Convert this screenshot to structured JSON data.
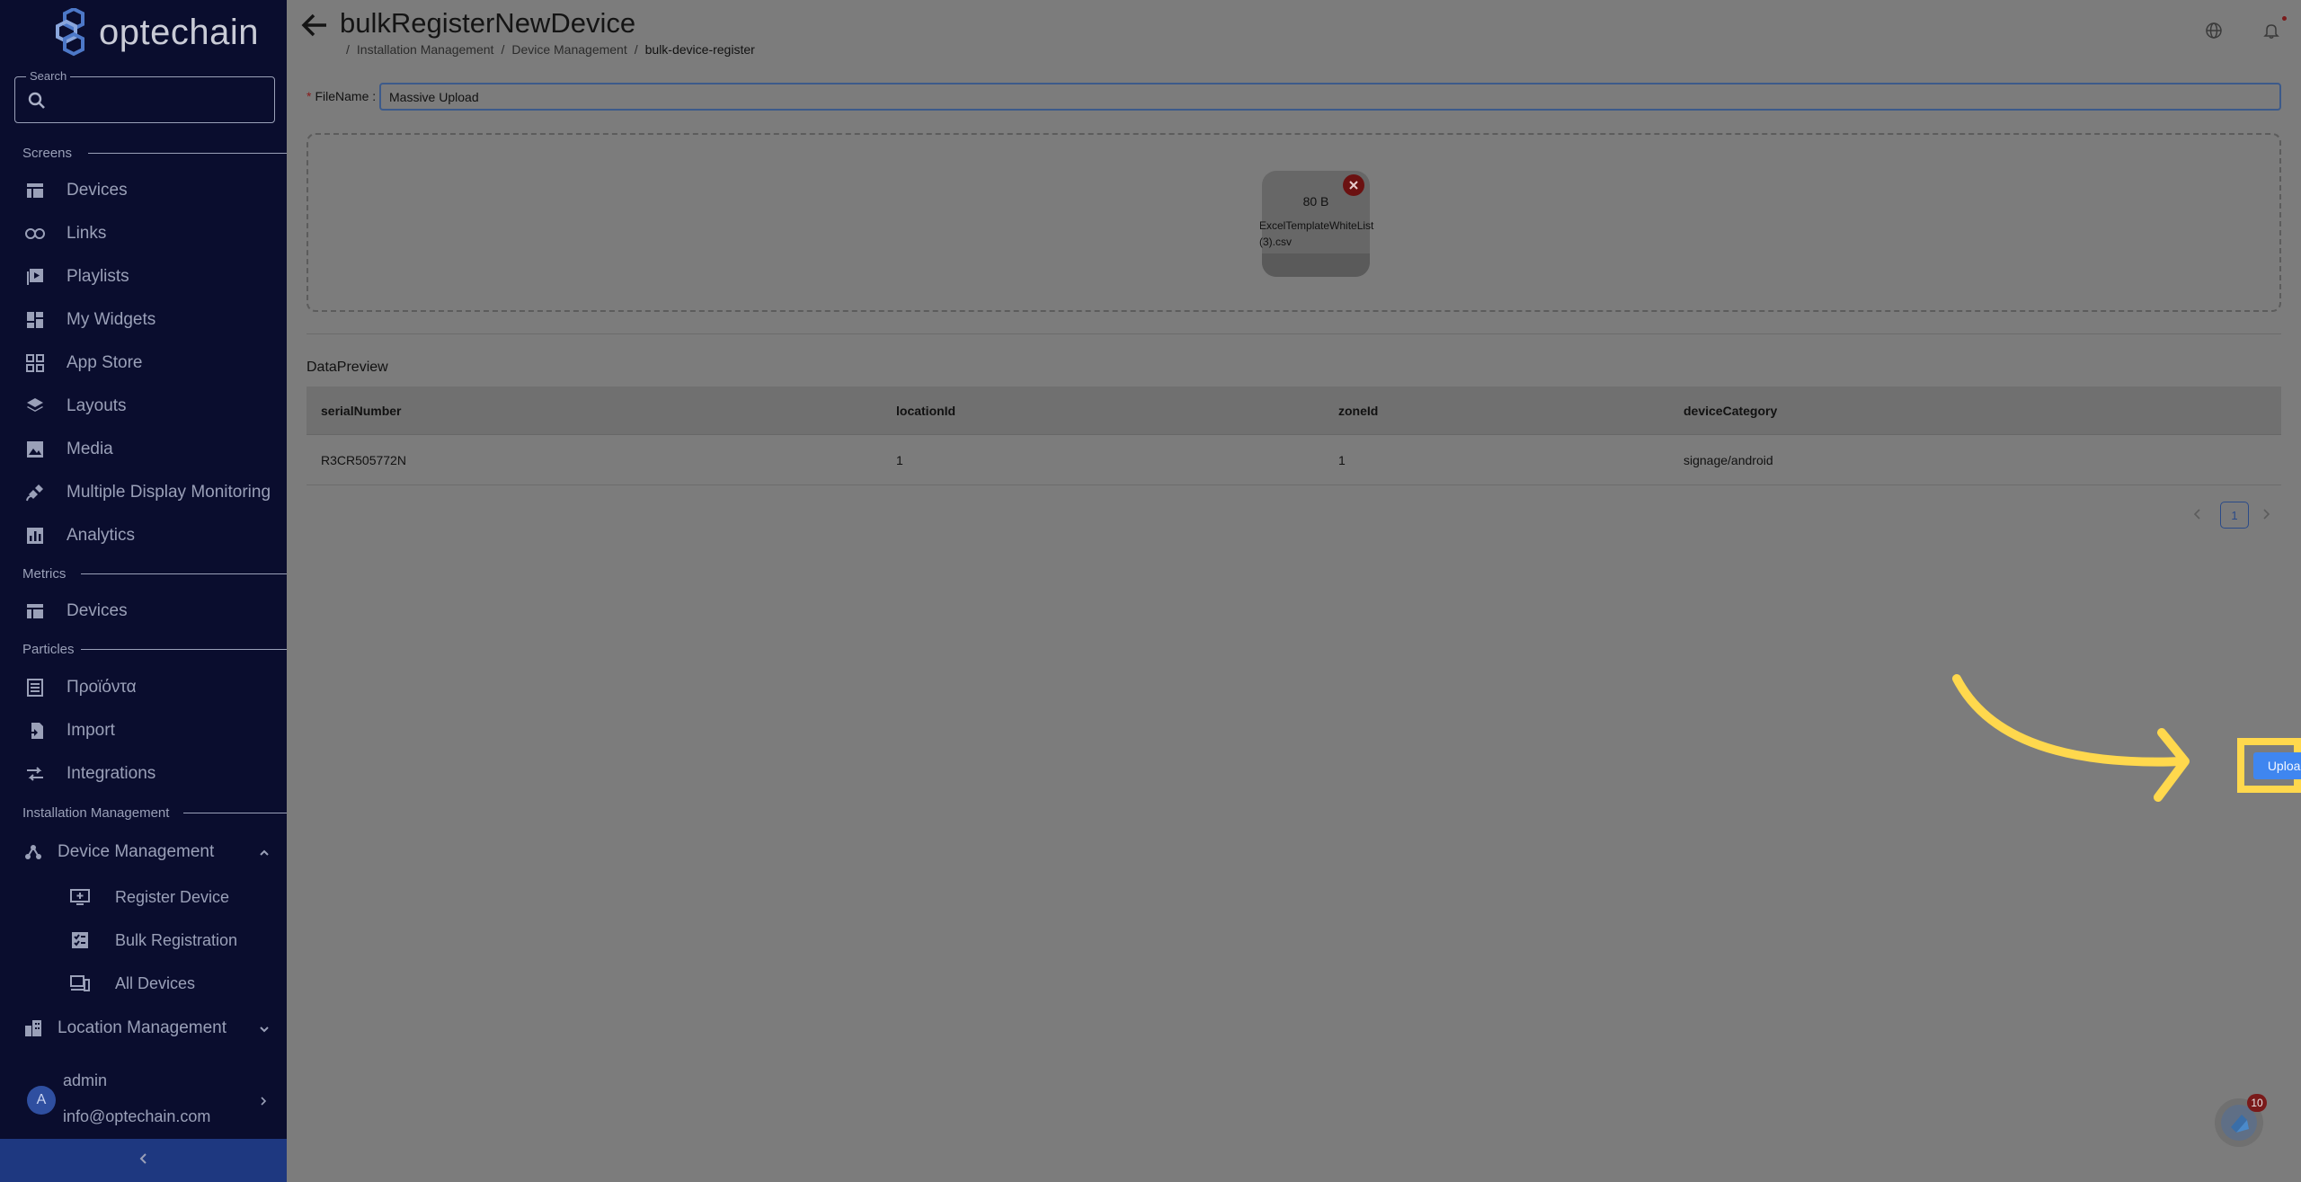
{
  "brand": {
    "name": "optechain"
  },
  "search": {
    "legend": "Search",
    "placeholder": ""
  },
  "sections": {
    "screens": "Screens",
    "metrics": "Metrics",
    "particles": "Particles",
    "installation": "Installation Management"
  },
  "nav": {
    "screens": [
      "Devices",
      "Links",
      "Playlists",
      "My Widgets",
      "App Store",
      "Layouts",
      "Media",
      "Multiple Display Monitoring",
      "Analytics"
    ],
    "metrics": [
      "Devices"
    ],
    "particles": [
      "Προϊόντα",
      "Import",
      "Integrations"
    ],
    "device_management": "Device Management",
    "device_sub": [
      "Register Device",
      "Bulk Registration",
      "All Devices"
    ],
    "location_management": "Location Management"
  },
  "user": {
    "initial": "A",
    "name": "admin",
    "email": "info@optechain.com"
  },
  "page": {
    "title": "bulkRegisterNewDevice",
    "breadcrumb": [
      "Installation Management",
      "Device Management",
      "bulk-device-register"
    ]
  },
  "form": {
    "filename_label": "FileName",
    "filename_value": "Massive Upload"
  },
  "file": {
    "size": "80 B",
    "name": "ExcelTemplateWhiteList (3).csv"
  },
  "preview": {
    "title": "DataPreview",
    "columns": [
      "serialNumber",
      "locationId",
      "zoneId",
      "deviceCategory"
    ],
    "rows": [
      [
        "R3CR505772N",
        "1",
        "1",
        "signage/android"
      ]
    ]
  },
  "pagination": {
    "current": "1"
  },
  "actions": {
    "upload": "Upload"
  },
  "support": {
    "badge": "10"
  },
  "colors": {
    "sidebar_bg": "#0a0d2e",
    "upload_button": "#3f86f0",
    "highlight": "#ffd84d"
  }
}
